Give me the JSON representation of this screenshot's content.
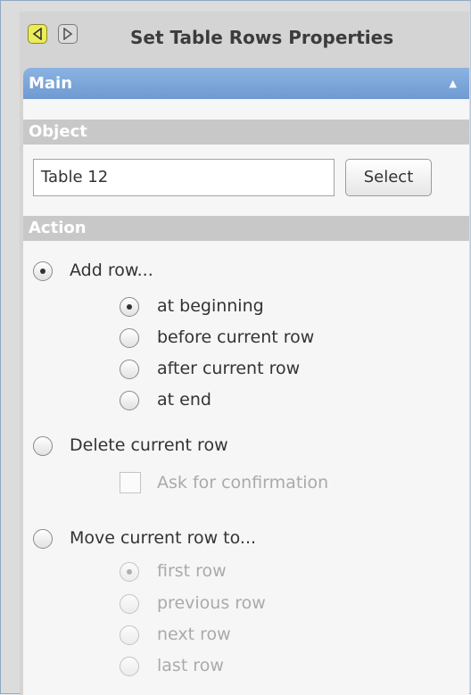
{
  "header": {
    "title": "Set Table Rows Properties",
    "back_icon": "back-arrow-icon",
    "forward_icon": "forward-arrow-icon"
  },
  "main_section": {
    "label": "Main",
    "collapse_glyph": "▲"
  },
  "object_section": {
    "label": "Object",
    "field_value": "Table 12",
    "select_label": "Select"
  },
  "action_section": {
    "label": "Action",
    "add_row": {
      "label": "Add row...",
      "selected": true,
      "options": [
        {
          "label": "at beginning",
          "selected": true
        },
        {
          "label": "before current row",
          "selected": false
        },
        {
          "label": "after current row",
          "selected": false
        },
        {
          "label": "at end",
          "selected": false
        }
      ]
    },
    "delete_row": {
      "label": "Delete current row",
      "selected": false,
      "confirm_label": "Ask for confirmation",
      "confirm_checked": false
    },
    "move_row": {
      "label": "Move current row to...",
      "selected": false,
      "options": [
        {
          "label": "first row",
          "selected": true
        },
        {
          "label": "previous row",
          "selected": false
        },
        {
          "label": "next row",
          "selected": false
        },
        {
          "label": "last row",
          "selected": false
        }
      ]
    }
  },
  "colors": {
    "main_bar": "#7ea6db",
    "section_bar": "#c8c8c8",
    "back_button": "#ecec5a"
  }
}
